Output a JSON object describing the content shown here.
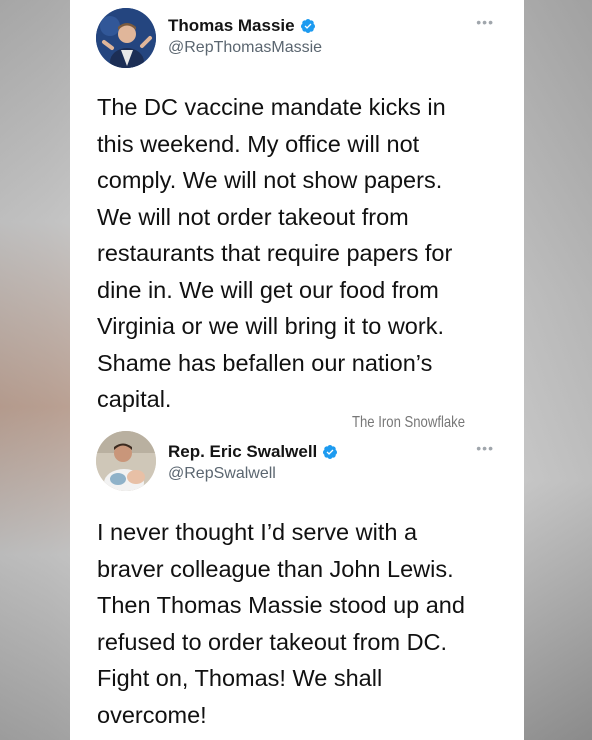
{
  "tweets": [
    {
      "display_name": "Thomas Massie",
      "handle": "@RepThomasMassie",
      "more_icon": "more-dots-icon",
      "verified_icon": "verified-badge-icon",
      "text": "The DC vaccine mandate kicks in\nthis weekend. My office will not\ncomply. We will not show papers.\nWe will not order takeout from\nrestaurants that require papers for\ndine in. We will get our food from\nVirginia or we will bring it to work.\nShame has befallen our nation’s\ncapital."
    },
    {
      "display_name": "Rep. Eric Swalwell",
      "handle": "@RepSwalwell",
      "more_icon": "more-dots-icon",
      "verified_icon": "verified-badge-icon",
      "text": "I never thought I’d serve with a\nbraver colleague than John Lewis.\nThen Thomas Massie stood up and\nrefused to order takeout from DC.\nFight on, Thomas! We shall\novercome!"
    }
  ],
  "watermark": "The Iron Snowflake",
  "colors": {
    "verified_blue": "#1d9bf0",
    "handle_gray": "#5b6670"
  }
}
